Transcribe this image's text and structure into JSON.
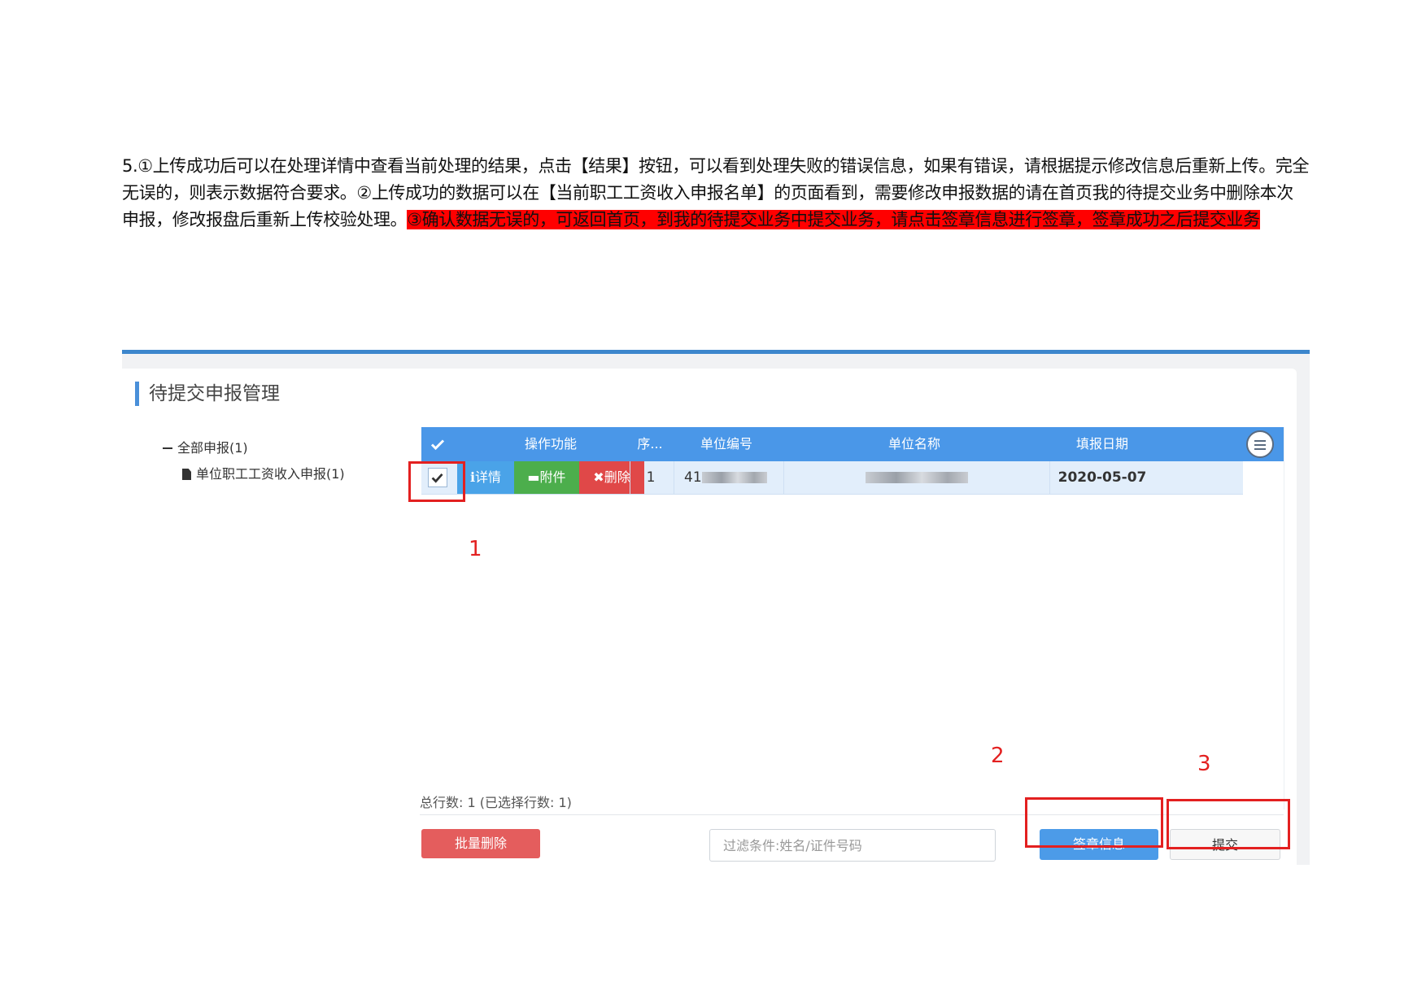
{
  "instruction": {
    "part1": "5.①上传成功后可以在处理详情中查看当前处理的结果，点击【结果】按钮，可以看到处理失败的错误信息，如果有错误，请根据提示修改信息后重新上传。完全无误的，则表示数据符合要求。②上传成功的数据可以在【当前职工工资收入申报名单】的页面看到，需要修改申报数据的请在首页我的待提交业务中删除本次申报，修改报盘后重新上传校验处理。",
    "highlight": "③确认数据无误的，可返回首页，到我的待提交业务中提交业务，请点击签章信息进行签章，签章成功之后提交业务",
    "highlight_color": "#ff0000"
  },
  "page": {
    "title": "待提交申报管理"
  },
  "tree": {
    "root": "全部申报(1)",
    "child": "单位职工工资收入申报(1)"
  },
  "table": {
    "columns": [
      "操作功能",
      "序...",
      "单位编号",
      "单位名称",
      "填报日期"
    ],
    "header_color": "#4a97e8",
    "rows": [
      {
        "actions": {
          "detail": "详情",
          "attach": "附件",
          "delete": "删除"
        },
        "seq": "1",
        "unit_code": "41",
        "unit_name": "",
        "date": "2020-05-07"
      }
    ]
  },
  "footer": {
    "count_text": "总行数:  1 (已选择行数:  1)",
    "batch_delete": "批量删除",
    "filter_placeholder": "过滤条件:姓名/证件号码",
    "sign": "签章信息",
    "submit": "提交"
  },
  "annotations": {
    "labels": [
      "1",
      "2",
      "3"
    ],
    "color": "#e32020"
  }
}
